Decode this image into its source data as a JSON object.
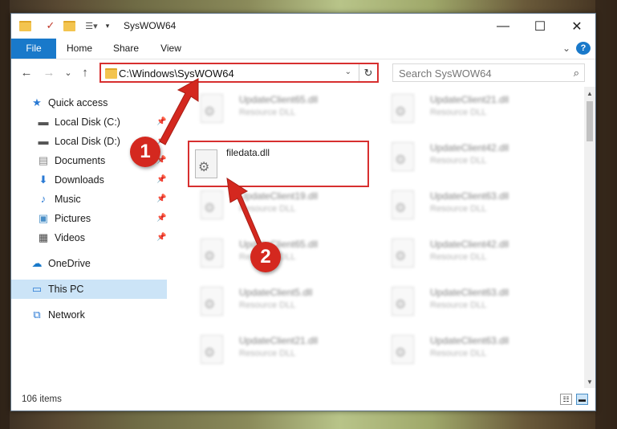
{
  "window": {
    "title": "SysWOW64",
    "controls": {
      "minimize": "—",
      "maximize": "☐",
      "close": "✕"
    }
  },
  "ribbon": {
    "tabs": [
      "File",
      "Home",
      "Share",
      "View"
    ],
    "expand": "⌄",
    "help": "?"
  },
  "nav": {
    "back": "←",
    "forward": "→",
    "recent": "⌄",
    "up": "↑"
  },
  "address": {
    "path": "C:\\Windows\\SysWOW64",
    "dropdown": "⌄",
    "refresh": "↻"
  },
  "search": {
    "placeholder": "Search SysWOW64"
  },
  "sidebar": {
    "items": [
      {
        "label": "Quick access",
        "icon": "star-icon",
        "pinned": false
      },
      {
        "label": "Local Disk (C:)",
        "icon": "drive-icon",
        "pinned": true
      },
      {
        "label": "Local Disk (D:)",
        "icon": "drive-icon",
        "pinned": true
      },
      {
        "label": "Documents",
        "icon": "documents-icon",
        "pinned": true
      },
      {
        "label": "Downloads",
        "icon": "download-icon",
        "pinned": true
      },
      {
        "label": "Music",
        "icon": "music-icon",
        "pinned": true
      },
      {
        "label": "Pictures",
        "icon": "pictures-icon",
        "pinned": true
      },
      {
        "label": "Videos",
        "icon": "videos-icon",
        "pinned": true
      },
      {
        "label": "OneDrive",
        "icon": "cloud-icon",
        "pinned": false
      },
      {
        "label": "This PC",
        "icon": "computer-icon",
        "pinned": false,
        "selected": true
      },
      {
        "label": "Network",
        "icon": "network-icon",
        "pinned": false
      }
    ]
  },
  "files": [
    {
      "name": "UpdateClient65.dll",
      "desc": "Resource DLL"
    },
    {
      "name": "UpdateClient21.dll",
      "desc": "Resource DLL"
    },
    {
      "name": "filedata.dll",
      "desc": ""
    },
    {
      "name": "UpdateClient42.dll",
      "desc": "Resource DLL"
    },
    {
      "name": "UpdateClient19.dll",
      "desc": "Resource DLL"
    },
    {
      "name": "UpdateClient63.dll",
      "desc": "Resource DLL"
    },
    {
      "name": "UpdateClient65.dll",
      "desc": "Resource DLL"
    },
    {
      "name": "UpdateClient42.dll",
      "desc": "Resource DLL"
    },
    {
      "name": "UpdateClient5.dll",
      "desc": "Resource DLL"
    },
    {
      "name": "UpdateClient63.dll",
      "desc": "Resource DLL"
    },
    {
      "name": "UpdateClient21.dll",
      "desc": "Resource DLL"
    },
    {
      "name": "UpdateClient63.dll",
      "desc": "Resource DLL"
    }
  ],
  "status": {
    "count": "106 items"
  },
  "callouts": {
    "one": "1",
    "two": "2"
  },
  "colors": {
    "accent": "#1979ca",
    "highlight": "#d72f2f",
    "callout": "#d4281f"
  }
}
